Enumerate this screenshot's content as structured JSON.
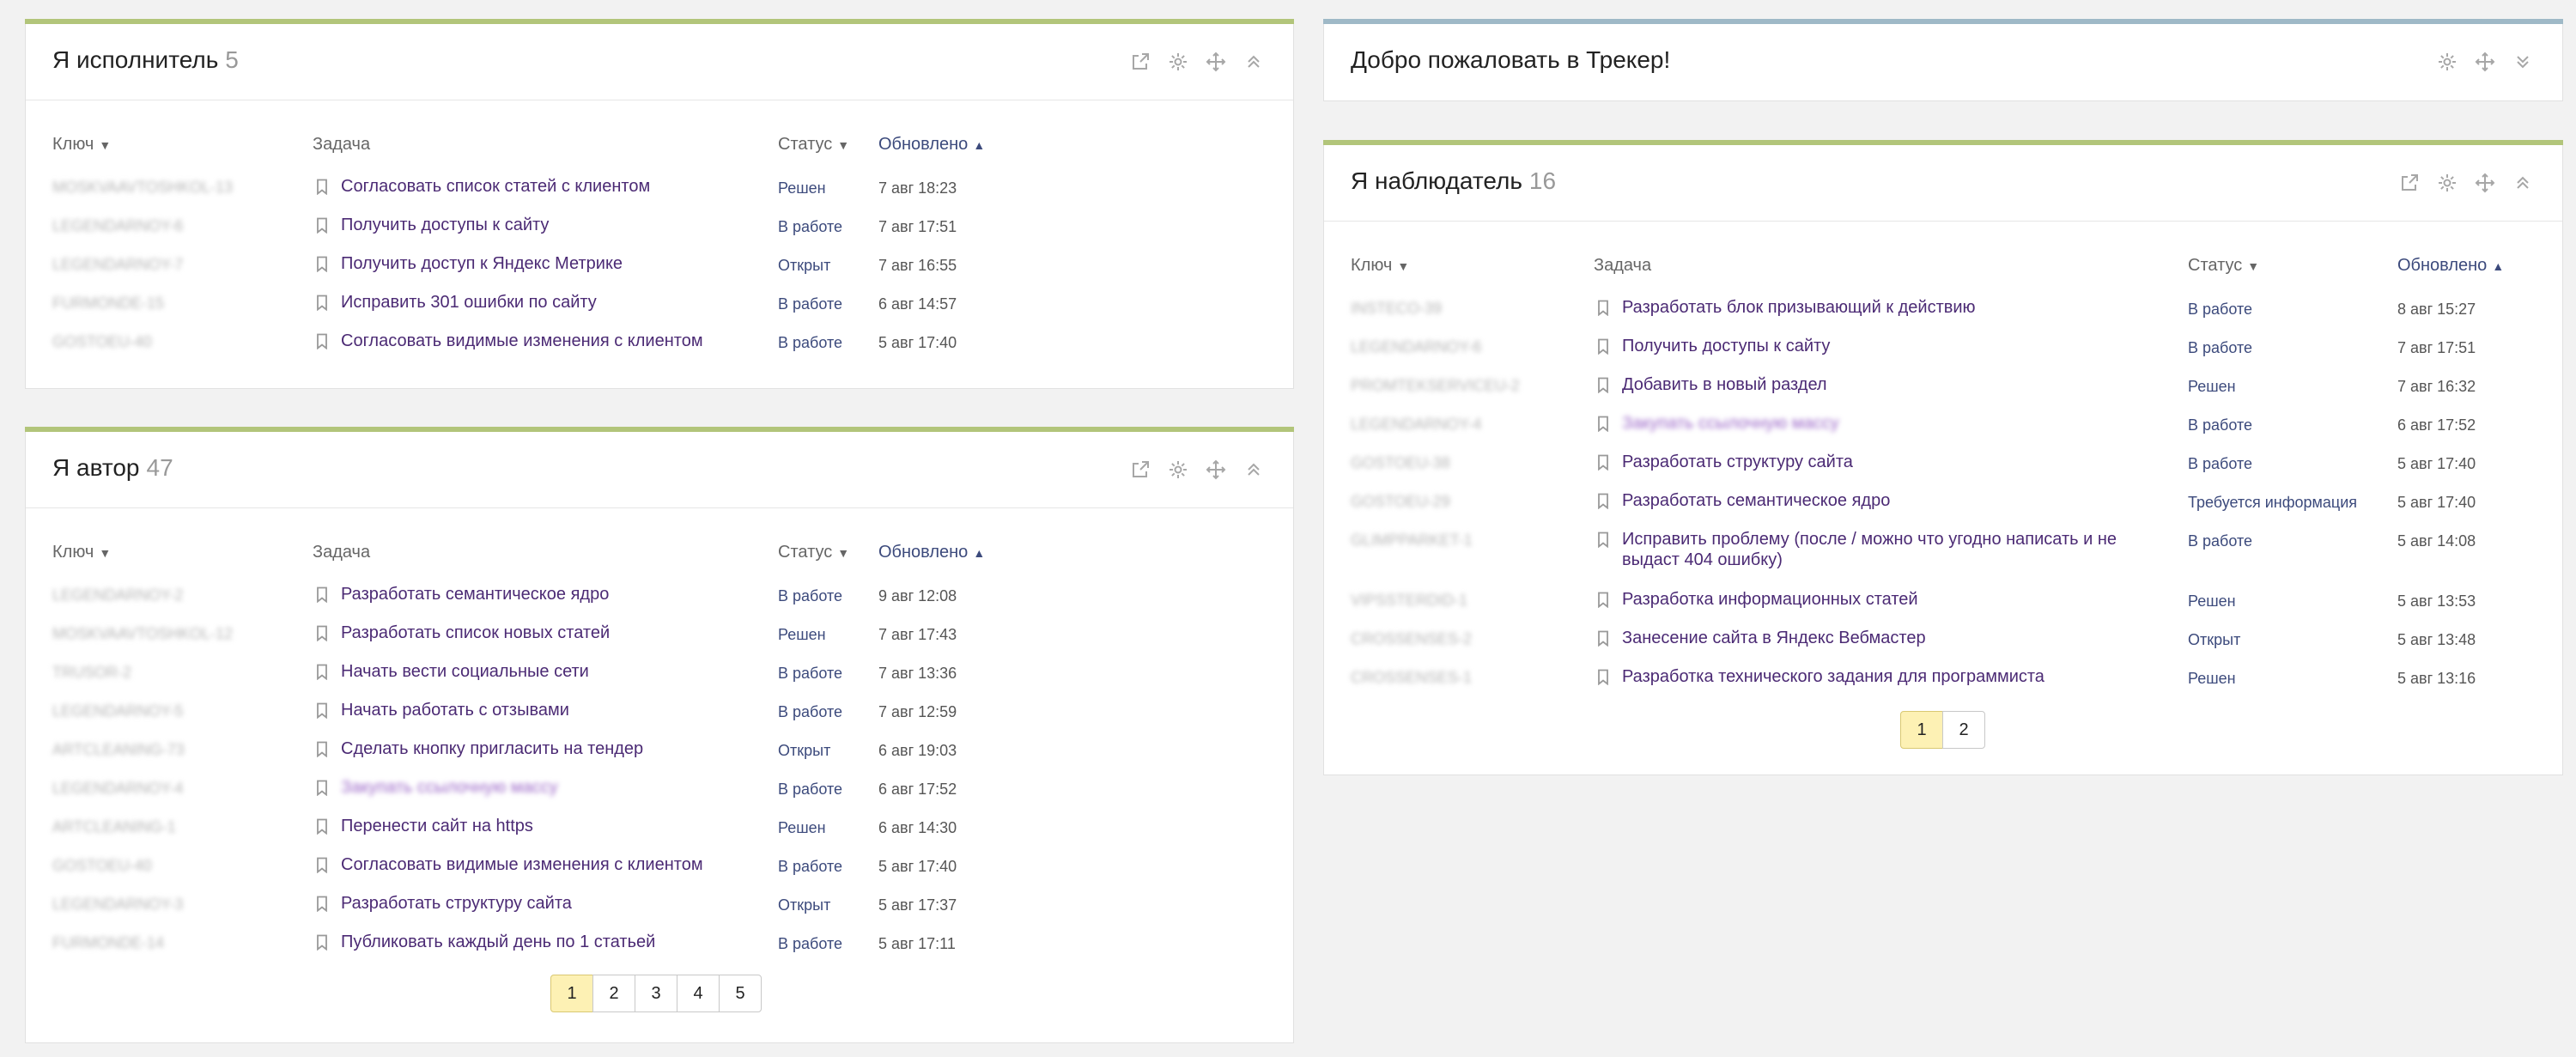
{
  "colors": {
    "green_bar": "#b2c57a",
    "blue_bar": "#9fb9c7",
    "link": "#4b2a74",
    "status": "#3c4a7c",
    "active_page": "#fdf1b4"
  },
  "icons": [
    "external-link-icon",
    "gear-icon",
    "move-icon",
    "collapse-icon",
    "expand-icon",
    "bookmark-icon"
  ],
  "assignee": {
    "title": "Я исполнитель",
    "count": "5",
    "columns": {
      "key": "Ключ",
      "task": "Задача",
      "status": "Статус",
      "updated": "Обновлено"
    },
    "rows": [
      {
        "key": "MOSKVAAVTOSHKOL-13",
        "task": "Согласовать список статей с клиентом",
        "status": "Решен",
        "updated": "7 авг 18:23"
      },
      {
        "key": "LEGENDARNOY-6",
        "task": "Получить доступы к сайту",
        "status": "В работе",
        "updated": "7 авг 17:51"
      },
      {
        "key": "LEGENDARNOY-7",
        "task": "Получить доступ к Яндекс Метрике",
        "status": "Открыт",
        "updated": "7 авг 16:55"
      },
      {
        "key": "FURMONDE-15",
        "task": "Исправить 301 ошибки по сайту",
        "status": "В работе",
        "updated": "6 авг 14:57"
      },
      {
        "key": "GOSTOEU-40",
        "task": "Согласовать видимые изменения с клиентом",
        "status": "В работе",
        "updated": "5 авг 17:40"
      }
    ]
  },
  "author": {
    "title": "Я автор",
    "count": "47",
    "columns": {
      "key": "Ключ",
      "task": "Задача",
      "status": "Статус",
      "updated": "Обновлено"
    },
    "rows": [
      {
        "key": "LEGENDARNOY-2",
        "task": "Разработать семантическое ядро",
        "status": "В работе",
        "updated": "9 авг 12:08"
      },
      {
        "key": "MOSKVAAVTOSHKOL-12",
        "task": "Разработать список новых статей",
        "status": "Решен",
        "updated": "7 авг 17:43"
      },
      {
        "key": "TRUSOR-2",
        "task": "Начать вести социальные сети",
        "status": "В работе",
        "updated": "7 авг 13:36"
      },
      {
        "key": "LEGENDARNOY-5",
        "task": "Начать работать с отзывами",
        "status": "В работе",
        "updated": "7 авг 12:59"
      },
      {
        "key": "ARTCLEANING-73",
        "task": "Сделать кнопку пригласить на тендер",
        "status": "Открыт",
        "updated": "6 авг 19:03"
      },
      {
        "key": "LEGENDARNOY-4",
        "task": "Закупать ссылочную массу",
        "status": "В работе",
        "updated": "6 авг 17:52"
      },
      {
        "key": "ARTCLEANING-1",
        "task": "Перенести сайт на https",
        "status": "Решен",
        "updated": "6 авг 14:30"
      },
      {
        "key": "GOSTOEU-40",
        "task": "Согласовать видимые изменения с клиентом",
        "status": "В работе",
        "updated": "5 авг 17:40"
      },
      {
        "key": "LEGENDARNOY-3",
        "task": "Разработать структуру сайта",
        "status": "Открыт",
        "updated": "5 авг 17:37"
      },
      {
        "key": "FURMONDE-14",
        "task": "Публиковать каждый день по 1 статьей",
        "status": "В работе",
        "updated": "5 авг 17:11"
      }
    ],
    "pages": [
      "1",
      "2",
      "3",
      "4",
      "5"
    ]
  },
  "welcome": {
    "title": "Добро пожаловать в Трекер!"
  },
  "watcher": {
    "title": "Я наблюдатель",
    "count": "16",
    "columns": {
      "key": "Ключ",
      "task": "Задача",
      "status": "Статус",
      "updated": "Обновлено"
    },
    "rows": [
      {
        "key": "INSTECO-39",
        "task": "Разработать блок призывающий к действию",
        "status": "В работе",
        "updated": "8 авг 15:27"
      },
      {
        "key": "LEGENDARNOY-6",
        "task": "Получить доступы к сайту",
        "status": "В работе",
        "updated": "7 авг 17:51"
      },
      {
        "key": "PROMTEKSERVICEU-2",
        "task": "Добавить в новый раздел",
        "status": "Решен",
        "updated": "7 авг 16:32"
      },
      {
        "key": "LEGENDARNOY-4",
        "task": "Закупать ссылочную массу",
        "status": "В работе",
        "updated": "6 авг 17:52"
      },
      {
        "key": "GOSTOEU-38",
        "task": "Разработать структуру сайта",
        "status": "В работе",
        "updated": "5 авг 17:40"
      },
      {
        "key": "GOSTOEU-29",
        "task": "Разработать семантическое ядро",
        "status": "Требуется информация",
        "updated": "5 авг 17:40"
      },
      {
        "key": "GLIMPPARKET-1",
        "task": "Исправить проблему (после / можно что угодно написать и не выдаст 404 ошибку)",
        "status": "В работе",
        "updated": "5 авг 14:08"
      },
      {
        "key": "VIPSSTERDID-1",
        "task": "Разработка информационных статей",
        "status": "Решен",
        "updated": "5 авг 13:53"
      },
      {
        "key": "CROSSENSES-2",
        "task": "Занесение сайта в Яндекс Вебмастер",
        "status": "Открыт",
        "updated": "5 авг 13:48"
      },
      {
        "key": "CROSSENSES-1",
        "task": "Разработка технического задания для программиста",
        "status": "Решен",
        "updated": "5 авг 13:16"
      }
    ],
    "pages": [
      "1",
      "2"
    ]
  }
}
